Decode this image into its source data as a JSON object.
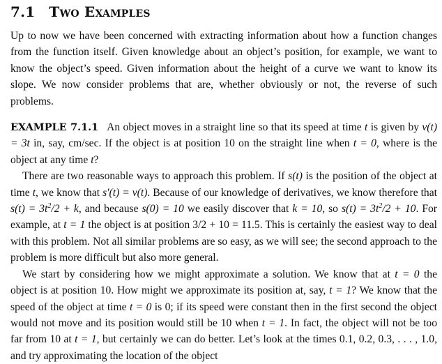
{
  "section": {
    "number": "7.1",
    "title_cap1": "T",
    "title_rest1": "WO",
    "title_cap2": "E",
    "title_rest2": "XAMPLES"
  },
  "paragraphs": {
    "intro": "Up to now we have been concerned with extracting information about how a function changes from the function itself. Given knowledge about an object’s position, for example, we want to know the object’s speed. Given information about the height of a curve we want to know its slope. We now consider problems that are, whether obviously or not, the reverse of such problems.",
    "example_label": "EXAMPLE 7.1.1",
    "example_text_1": "An object moves in a straight line so that its speed at time ",
    "example_text_2": " is given by ",
    "example_text_3": " in, say, cm/sec. If the object is at position 10 on the straight line when ",
    "example_text_4": ", where is the object at any time ",
    "example_text_5": "?",
    "p2_a": "There are two reasonable ways to approach this problem. If ",
    "p2_b": " is the position of the object at time ",
    "p2_c": ", we know that ",
    "p2_d": ". Because of our knowledge of derivatives, we know therefore that ",
    "p2_e": ", and because ",
    "p2_f": " we easily discover that ",
    "p2_g": ", so ",
    "p2_h": ". For example, at ",
    "p2_i": " the object is at position ",
    "p2_j": ". This is certainly the easiest way to deal with this problem. Not all similar problems are so easy, as we will see; the second approach to the problem is more difficult but also more general.",
    "p3_a": "We start by considering how we might approximate a solution. We know that at ",
    "p3_b": " the object is at position 10. How might we approximate its position at, say, ",
    "p3_c": "? We know that the speed of the object at time ",
    "p3_d": " is 0; if its speed were constant then in the first second the object would not move and its position would still be 10 when ",
    "p3_e": ". In fact, the object will not be too far from 10 at ",
    "p3_f": ", but certainly we can do better. Let’s look at the times 0.1, 0.2, 0.3, . . . , 1.0, and try approximating the location of the object"
  },
  "math": {
    "t": "t",
    "vt": "v(t) = 3t",
    "t_eq_0": "t = 0",
    "st": "s(t)",
    "sprime": "s′(t) = v(t)",
    "st_general_pre": "s(t) = 3t",
    "st_general_post": "/2 + k",
    "s0": "s(0) = 10",
    "k10": "k = 10",
    "st_final_post": "/2 + 10",
    "t_eq_1": "t = 1",
    "pos_value": "3/2 + 10 = 11.5",
    "exp2": "2"
  }
}
